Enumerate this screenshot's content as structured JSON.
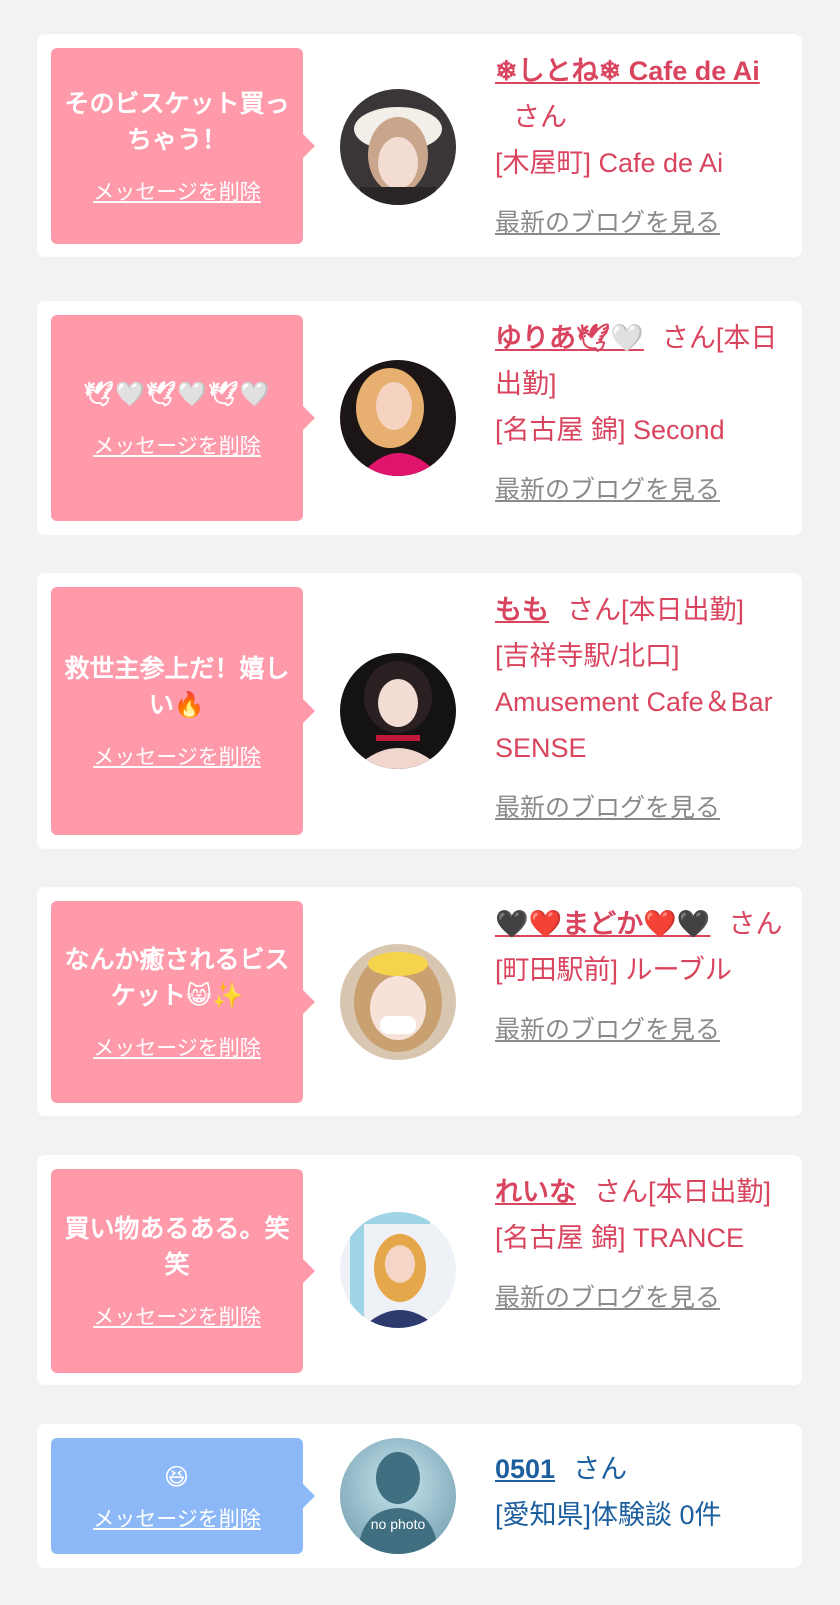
{
  "delete_label": "メッセージを削除",
  "blog_label": "最新のブログを見る",
  "colors": {
    "page_bg": "#f2f2f2",
    "card_bg": "#ffffff",
    "bubble_pink": "#ff9aab",
    "bubble_blue": "#8cb8f8",
    "text_pink": "#d9445e",
    "text_blue": "#1d5f9e",
    "link_gray": "#8a8a8a"
  },
  "cards": [
    {
      "message": "そのビスケット買っちゃう！",
      "name": "❄しとね❄ Cafe de Ai",
      "suffix": "さん",
      "shop": "[木屋町] Cafe de Ai",
      "avatar_icon": "photo-avatar"
    },
    {
      "message": "🕊🤍🕊🤍🕊🤍",
      "name": "ゆりあ🕊🤍",
      "suffix": "さん[本日出勤]",
      "shop": "[名古屋 錦] Second",
      "avatar_icon": "photo-avatar"
    },
    {
      "message": "救世主参上だ！嬉しい🔥",
      "name": "もも",
      "suffix": "さん[本日出勤]",
      "shop": "[吉祥寺駅/北口] Amusement Cafe＆Bar SENSE",
      "avatar_icon": "photo-avatar"
    },
    {
      "message": "なんか癒されるビスケット😸✨",
      "name": "🖤❤️まどか❤️🖤",
      "suffix": "さん",
      "shop": "[町田駅前] ルーブル",
      "avatar_icon": "photo-avatar"
    },
    {
      "message": "買い物あるある。笑笑",
      "name": "れいな",
      "suffix": "さん[本日出勤]",
      "shop": "[名古屋 錦] TRANCE",
      "avatar_icon": "photo-avatar"
    },
    {
      "message": "😆",
      "name": "0501",
      "suffix": "さん",
      "shop": "[愛知県]体験談 0件",
      "avatar_text": "no photo",
      "avatar_icon": "silhouette-avatar"
    }
  ]
}
